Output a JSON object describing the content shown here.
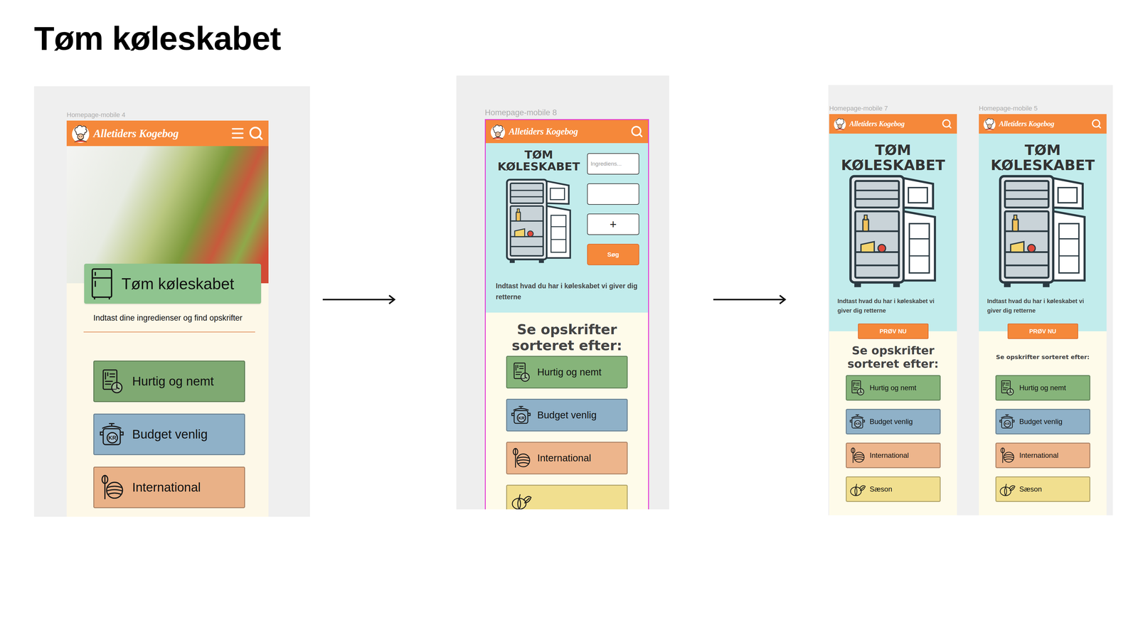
{
  "title": "Tøm køleskabet",
  "panels": [
    {
      "phones": [
        {
          "label": "Homepage-mobile 4",
          "kind": "photo",
          "selected": false,
          "logo": "Alletiders Kogebog",
          "menu": true,
          "feature": {
            "title": "Tøm køleskabet",
            "subtitle": "Indtast dine ingredienser og find opskrifter"
          },
          "categories": [
            {
              "kind": "quick",
              "label": "Hurtig og nemt",
              "color": "#7fa972"
            },
            {
              "kind": "budget",
              "label": "Budget venlig",
              "color": "#8fb1c8",
              "iconText": "KR"
            },
            {
              "kind": "international",
              "label": "International",
              "color": "#e9b187"
            }
          ]
        }
      ]
    },
    {
      "phones": [
        {
          "label": "Homepage-mobile 8",
          "kind": "form",
          "selected": true,
          "logo": "Alletiders Kogebog",
          "menu": false,
          "hero": {
            "title": "TØM KØLESKABET",
            "text": "Indtast hvad du har i køleskabet vi giver dig retterne",
            "fields": [
              {
                "placeholder": "Ingrediens...",
                "value": ""
              },
              {
                "placeholder": "",
                "value": ""
              }
            ],
            "addButton": "+",
            "searchButton": "Søg"
          },
          "sectionTitle": "Se opskrifter sorteret efter:",
          "sectionSize": "large",
          "categories": [
            {
              "kind": "quick",
              "label": "Hurtig og nemt",
              "color": "#86b47a"
            },
            {
              "kind": "budget",
              "label": "Budget venlig",
              "color": "#8fb1c8",
              "iconText": "KR"
            },
            {
              "kind": "international",
              "label": "International",
              "color": "#edb58c"
            },
            {
              "kind": "season",
              "label": "",
              "color": "#f1df8f"
            }
          ]
        }
      ]
    },
    {
      "phones": [
        {
          "label": "Homepage-mobile 7",
          "kind": "cta",
          "selected": false,
          "logo": "Alletiders Kogebog",
          "menu": false,
          "hero": {
            "title": "TØM KØLESKABET",
            "text": "Indtast hvad du har i køleskabet vi giver dig retterne",
            "cta": "PRØV NU"
          },
          "sectionTitle": "Se opskrifter sorteret efter:",
          "sectionSize": "large",
          "categories": [
            {
              "kind": "quick",
              "label": "Hurtig og nemt",
              "color": "#86b47a"
            },
            {
              "kind": "budget",
              "label": "Budget venlig",
              "color": "#8fb1c8",
              "iconText": "KR"
            },
            {
              "kind": "international",
              "label": "International",
              "color": "#edb58c"
            },
            {
              "kind": "season",
              "label": "Sæson",
              "color": "#f1df8f"
            }
          ]
        },
        {
          "label": "Homepage-mobile 5",
          "kind": "cta",
          "selected": false,
          "logo": "Alletiders Kogebog",
          "menu": false,
          "hero": {
            "title": "TØM KØLESKABET",
            "text": "Indtast hvad du har i køleskabet vi giver dig retterne",
            "cta": "PRØV NU"
          },
          "sectionTitle": "Se opskrifter sorteret efter:",
          "sectionSize": "small",
          "categories": [
            {
              "kind": "quick",
              "label": "Hurtig og nemt",
              "color": "#86b47a"
            },
            {
              "kind": "budget",
              "label": "Budget venlig",
              "color": "#8fb1c8",
              "iconText": "KR"
            },
            {
              "kind": "international",
              "label": "International",
              "color": "#edb58c"
            },
            {
              "kind": "season",
              "label": "Sæson",
              "color": "#f1df8f"
            }
          ]
        }
      ]
    }
  ]
}
